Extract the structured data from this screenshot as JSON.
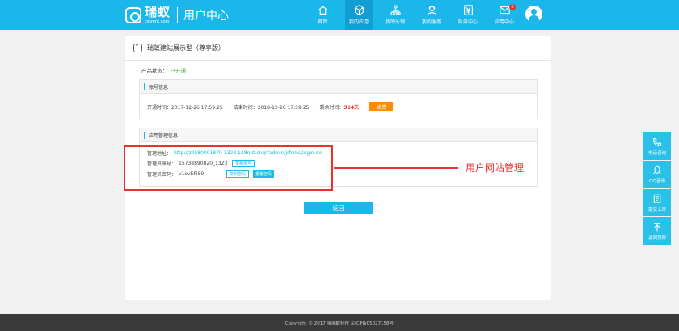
{
  "header": {
    "logo_cn": "瑞蚁",
    "logo_en": "cssrent.com",
    "title": "用户中心",
    "nav": [
      {
        "label": "首页",
        "icon": "home-icon"
      },
      {
        "label": "我的应用",
        "icon": "cube-icon",
        "active": true
      },
      {
        "label": "我的分销",
        "icon": "network-icon"
      },
      {
        "label": "我的服务",
        "icon": "user-service-icon"
      },
      {
        "label": "财务中心",
        "icon": "yen-icon"
      },
      {
        "label": "应用中心",
        "icon": "mail-icon",
        "badge": "6"
      }
    ]
  },
  "page": {
    "title": "瑞蚁建站展示型（尊享版）",
    "status_label": "产品状态：",
    "status_value": "已开通"
  },
  "account": {
    "header": "账号信息",
    "open_time": "开通时间：2017-12-26 17:59:25",
    "end_time": "结束时间：2018-12-26 17:59:25",
    "remain_label": "剩余时间：",
    "remain_value": "364天",
    "renew_button": "续费"
  },
  "management": {
    "header": "应用管理信息",
    "url_label": "管理地址：",
    "url_value": "http://z2580001879-1323.128net.cn/jrfadmin/jrfcms/login.do",
    "account_label": "管理员账号：",
    "account_value": "15738890820_1323",
    "copy_account_button": "复制账号",
    "password_label": "管理员密码：",
    "password_value": "v1ovEPiS9",
    "copy_password_button": "复制密码",
    "reset_password_button": "重置密码"
  },
  "annotation": "用户网站管理",
  "back_button": "返回",
  "sidebar": [
    {
      "label": "电话咨询",
      "icon": "phone-icon"
    },
    {
      "label": "QQ咨询",
      "icon": "qq-icon"
    },
    {
      "label": "提交工单",
      "icon": "ticket-icon"
    },
    {
      "label": "返回顶部",
      "icon": "back-to-top-icon"
    }
  ],
  "footer": "Copyright © 2017 金瑞蚁科技 京ICP备05027158号",
  "colors": {
    "primary": "#1bb6ea",
    "warning": "#ff8a00",
    "alert": "#e8332b",
    "success": "#3aae3a"
  }
}
